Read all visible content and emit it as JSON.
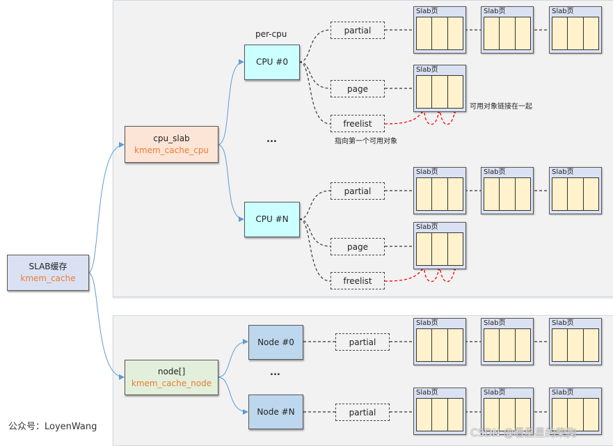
{
  "root": {
    "title": "SLAB缓存",
    "subtitle": "kmem_cache"
  },
  "cpu_slab": {
    "title": "cpu_slab",
    "subtitle": "kmem_cache_cpu"
  },
  "node_array": {
    "title": "node[]",
    "subtitle": "kmem_cache_node"
  },
  "per_cpu_label": "per-cpu",
  "ellipsis": "...",
  "cpus": [
    {
      "label": "CPU #0",
      "fields": [
        "partial",
        "page",
        "freelist"
      ]
    },
    {
      "label": "CPU #N",
      "fields": [
        "partial",
        "page",
        "freelist"
      ]
    }
  ],
  "nodes": [
    {
      "label": "Node #0",
      "field": "partial"
    },
    {
      "label": "Node #N",
      "field": "partial"
    }
  ],
  "slab_page_label": "Slab页",
  "annotations": {
    "freelist_note": "指向第一个可用对象",
    "linked_note": "可用对象链接在一起"
  },
  "colors": {
    "root_fill": "#dae1f3",
    "cpu_slab_fill": "#fce4d6",
    "node_array_fill": "#e2efda",
    "cpu_fill": "#ccffff",
    "node_fill": "#bdd7ee",
    "slab_cell_fill": "#fff2cc",
    "accent_text": "#ed7d31",
    "arrow_blue": "#5b9bd5",
    "freelist_red": "#ff0000"
  },
  "footer": {
    "author": "公众号：LoyenWang",
    "watermark": "CSDN @看星星的柴狗"
  }
}
